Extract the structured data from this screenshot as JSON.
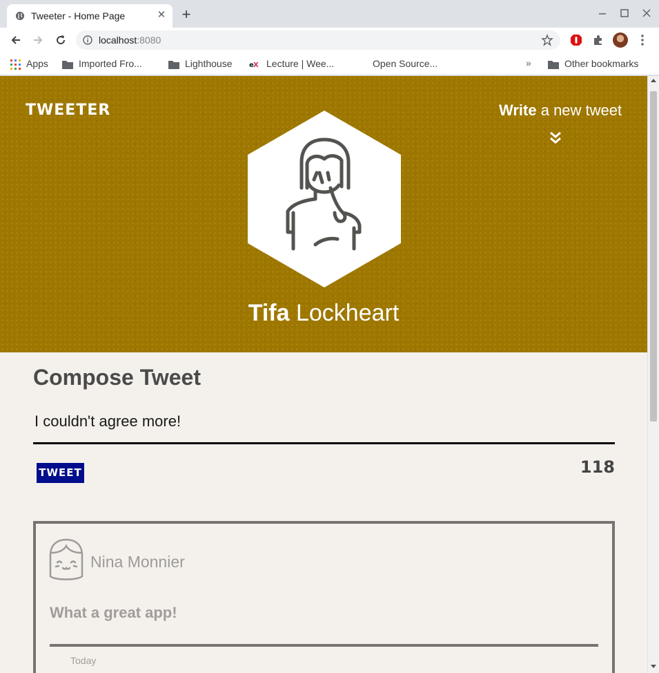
{
  "browser": {
    "tab_title": "Tweeter - Home Page",
    "url_host": "localhost",
    "url_port": ":8080",
    "bookmarks": [
      {
        "label": "Apps",
        "icon": "apps-grid-icon"
      },
      {
        "label": "Imported Fro...",
        "icon": "folder-icon"
      },
      {
        "label": "Lighthouse",
        "icon": "folder-icon"
      },
      {
        "label": "Lecture | Wee...",
        "icon": "edx-icon"
      },
      {
        "label": "Open Source...",
        "icon": "none"
      }
    ],
    "overflow": "»",
    "other_bookmarks": "Other bookmarks"
  },
  "header": {
    "brand": "TWEETER",
    "write_strong": "Write",
    "write_rest": " a new tweet",
    "accent": "#9e7700"
  },
  "profile": {
    "first_name": "Tifa",
    "last_name": " Lockheart"
  },
  "compose": {
    "title": "Compose Tweet",
    "input_value": "I couldn't agree more!",
    "button_label": "TWEET",
    "counter": "118",
    "button_color": "#000d8c"
  },
  "tweets": [
    {
      "author": "Nina Monnier",
      "text": "What a great app!",
      "date": "Today"
    }
  ]
}
